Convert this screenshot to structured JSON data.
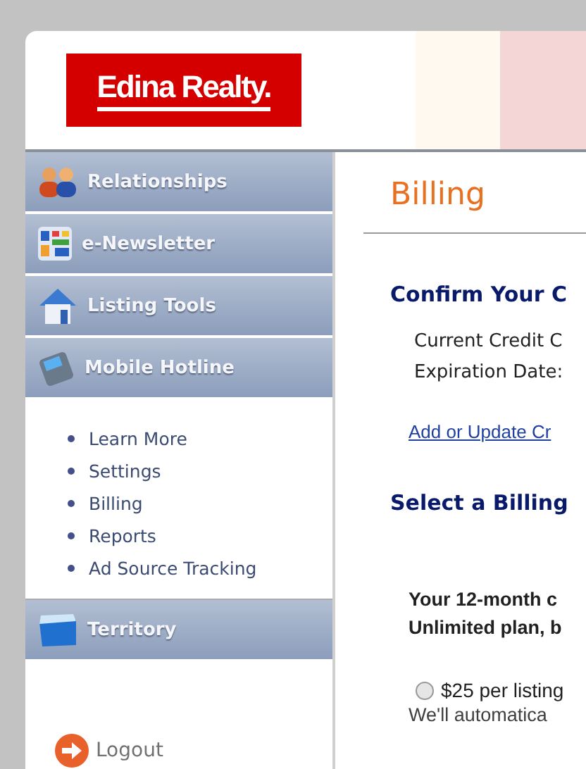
{
  "header": {
    "logo": "Edina Realty."
  },
  "sidebar": {
    "items": [
      {
        "label": "Relationships"
      },
      {
        "label": "e-Newsletter"
      },
      {
        "label": "Listing Tools"
      },
      {
        "label": "Mobile Hotline",
        "children": [
          {
            "label": "Learn More"
          },
          {
            "label": "Settings"
          },
          {
            "label": "Billing"
          },
          {
            "label": "Reports"
          },
          {
            "label": "Ad Source Tracking"
          }
        ]
      },
      {
        "label": "Territory"
      }
    ],
    "logout": "Logout"
  },
  "content": {
    "title": "Billing",
    "confirm_heading": "Confirm Your C",
    "card_lines": [
      "Current Credit C",
      "Expiration Date:"
    ],
    "update_link": "Add or Update Cr",
    "select_heading": "Select a Billing",
    "plan_text": [
      "Your 12-month c",
      "Unlimited plan, b"
    ],
    "options": [
      {
        "label": "$25 per listing",
        "selected": false
      }
    ],
    "note": "We'll automatica"
  }
}
